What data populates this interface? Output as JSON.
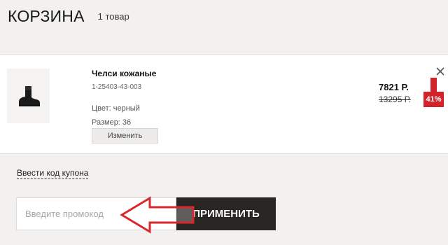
{
  "header": {
    "title": "КОРЗИНА",
    "count": "1 товар"
  },
  "item": {
    "name": "Челси кожаные",
    "sku": "1-25403-43-003",
    "color": "Цвет: черный",
    "size": "Размер: 36",
    "change_label": "Изменить",
    "price": "7821 Р.",
    "old_price": "13295 Р.",
    "discount": "41%",
    "thumbnail_icon": "ankle-boot-icon"
  },
  "coupon": {
    "link_label": "Ввести код купона",
    "input_placeholder": "Введите промокод",
    "input_value": "",
    "apply_label": "ПРИМЕНИТЬ"
  },
  "colors": {
    "accent": "#d2232a",
    "button_dark": "#2a2624",
    "annotation": "#d9272e"
  }
}
